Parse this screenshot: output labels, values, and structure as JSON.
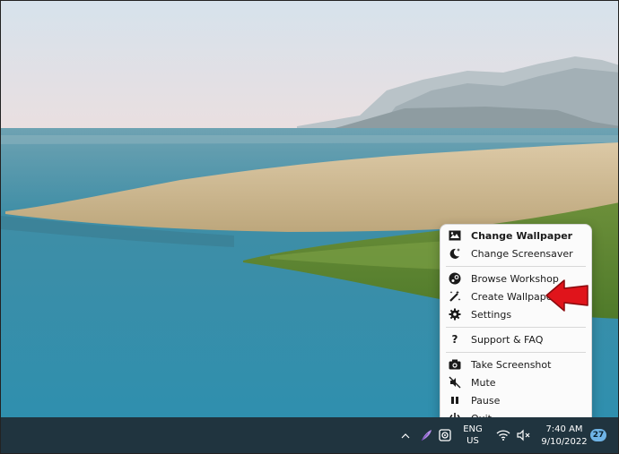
{
  "menu": {
    "items": [
      {
        "label": "Change Wallpaper",
        "icon": "image-icon",
        "bold": true
      },
      {
        "label": "Change Screensaver",
        "icon": "moon-icon"
      },
      {
        "label": "Browse Workshop",
        "icon": "steam-icon"
      },
      {
        "label": "Create Wallpaper",
        "icon": "magic-wand-icon"
      },
      {
        "label": "Settings",
        "icon": "gear-icon"
      },
      {
        "label": "Support & FAQ",
        "icon": "question-icon"
      },
      {
        "label": "Take Screenshot",
        "icon": "camera-icon"
      },
      {
        "label": "Mute",
        "icon": "speaker-muted-icon"
      },
      {
        "label": "Pause",
        "icon": "pause-icon"
      },
      {
        "label": "Quit",
        "icon": "power-icon"
      }
    ]
  },
  "taskbar": {
    "language_top": "ENG",
    "language_bottom": "US",
    "time": "7:40 AM",
    "date": "9/10/2022",
    "notification_count": "27"
  },
  "colors": {
    "taskbar_bg": "#20343f",
    "arrow": "#e0141b",
    "badge": "#6fb4e6"
  }
}
